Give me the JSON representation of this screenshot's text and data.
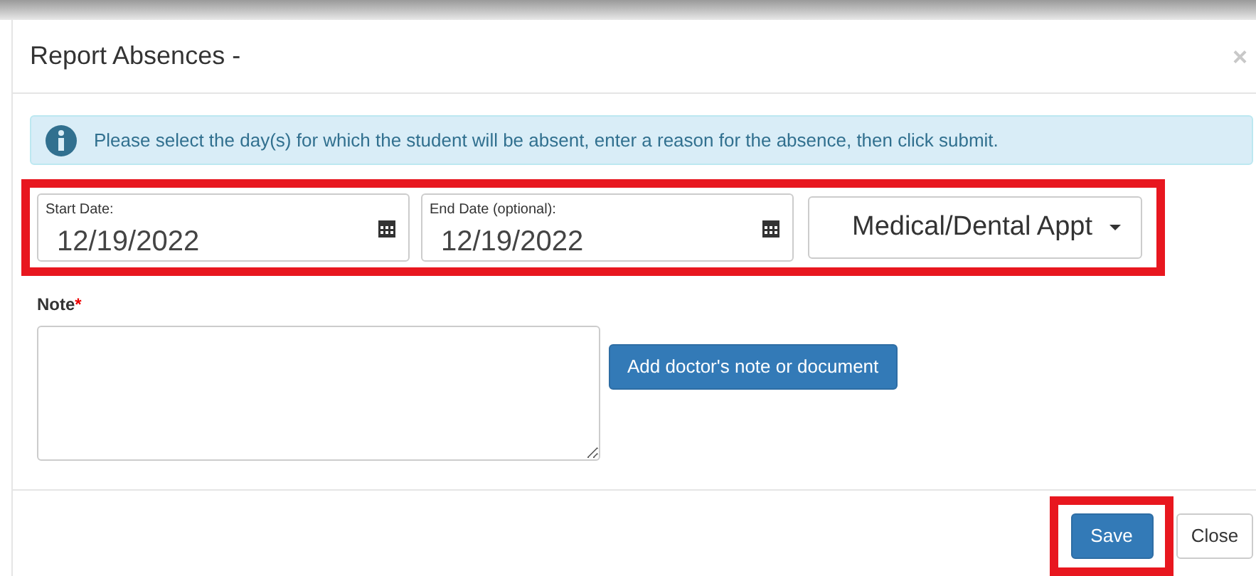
{
  "dialog": {
    "title": "Report Absences -",
    "close_glyph": "×"
  },
  "info": {
    "text": "Please select the day(s) for which the student will be absent, enter a reason for the absence, then click submit."
  },
  "fields": [
    {
      "kind": "date",
      "label": "Start Date:",
      "value": "12/19/2022"
    },
    {
      "kind": "date",
      "label": "End Date (optional):",
      "value": "12/19/2022"
    },
    {
      "kind": "select",
      "value": "Medical/Dental Appt"
    }
  ],
  "note": {
    "label": "Note",
    "required_mark": "*"
  },
  "attach_button": "Add doctor's note or document",
  "buttons": [
    {
      "kind": "primary",
      "label": "Save"
    },
    {
      "kind": "default",
      "label": "Close"
    }
  ]
}
